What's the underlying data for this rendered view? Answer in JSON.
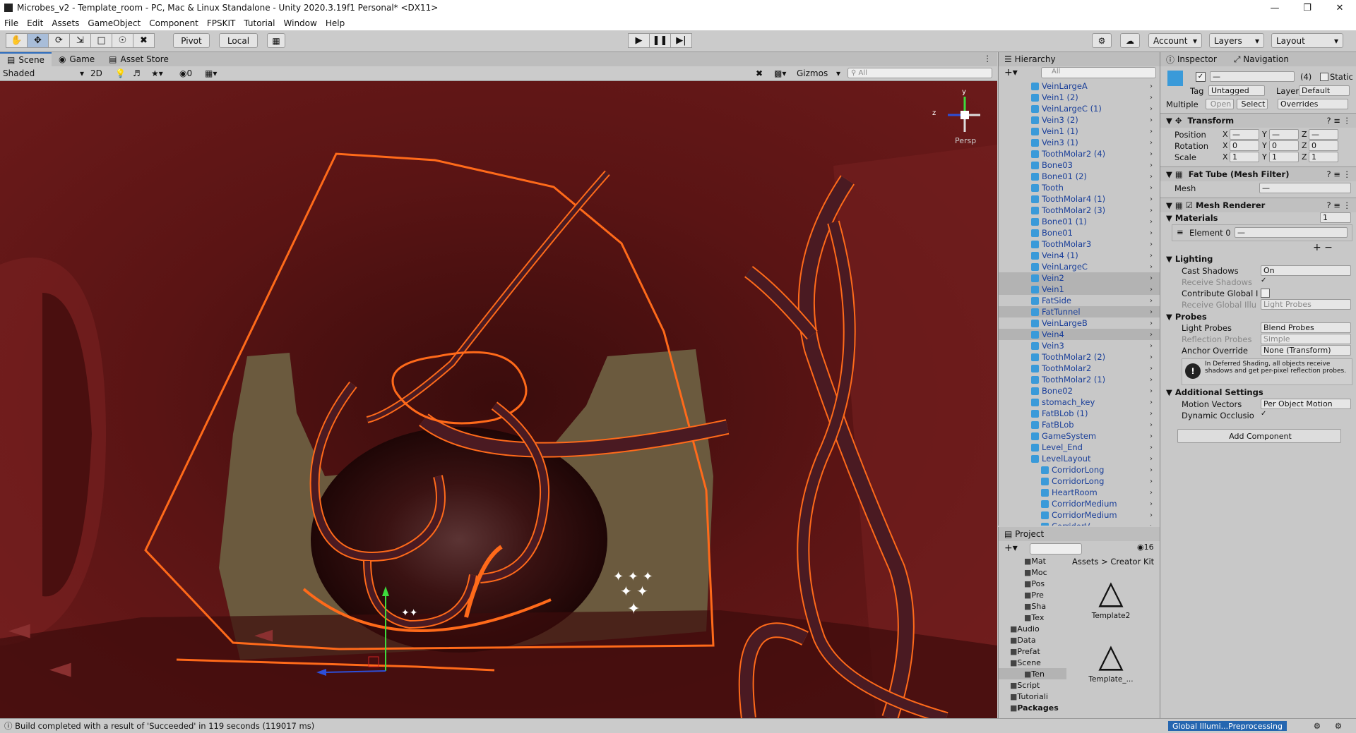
{
  "window": {
    "title": "Microbes_v2 - Template_room - PC, Mac & Linux Standalone - Unity 2020.3.19f1 Personal* <DX11>"
  },
  "menu": [
    "File",
    "Edit",
    "Assets",
    "GameObject",
    "Component",
    "FPSKIT",
    "Tutorial",
    "Window",
    "Help"
  ],
  "toolbar": {
    "pivot": "Pivot",
    "local": "Local",
    "account": "Account",
    "layers": "Layers",
    "layout": "Layout"
  },
  "scene": {
    "tabs": [
      "Scene",
      "Game",
      "Asset Store"
    ],
    "shading": "Shaded",
    "mode_2d": "2D",
    "hidden_count": "0",
    "gizmos": "Gizmos",
    "search_placeholder": "All",
    "persp": "Persp",
    "axis_y": "y",
    "axis_z": "z"
  },
  "hierarchy": {
    "tab": "Hierarchy",
    "search_placeholder": "All",
    "items": [
      {
        "label": "VeinLargeA",
        "sel": false,
        "indent": 1
      },
      {
        "label": "Vein1 (2)",
        "sel": false,
        "indent": 1
      },
      {
        "label": "VeinLargeC (1)",
        "sel": false,
        "indent": 1
      },
      {
        "label": "Vein3 (2)",
        "sel": false,
        "indent": 1
      },
      {
        "label": "Vein1 (1)",
        "sel": false,
        "indent": 1
      },
      {
        "label": "Vein3 (1)",
        "sel": false,
        "indent": 1
      },
      {
        "label": "ToothMolar2 (4)",
        "sel": false,
        "indent": 1
      },
      {
        "label": "Bone03",
        "sel": false,
        "indent": 1
      },
      {
        "label": "Bone01 (2)",
        "sel": false,
        "indent": 1
      },
      {
        "label": "Tooth",
        "sel": false,
        "indent": 1
      },
      {
        "label": "ToothMolar4 (1)",
        "sel": false,
        "indent": 1
      },
      {
        "label": "ToothMolar2 (3)",
        "sel": false,
        "indent": 1
      },
      {
        "label": "Bone01 (1)",
        "sel": false,
        "indent": 1
      },
      {
        "label": "Bone01",
        "sel": false,
        "indent": 1
      },
      {
        "label": "ToothMolar3",
        "sel": false,
        "indent": 1
      },
      {
        "label": "Vein4 (1)",
        "sel": false,
        "indent": 1
      },
      {
        "label": "VeinLargeC",
        "sel": false,
        "indent": 1
      },
      {
        "label": "Vein2",
        "sel": true,
        "indent": 1
      },
      {
        "label": "Vein1",
        "sel": true,
        "indent": 1
      },
      {
        "label": "FatSide",
        "sel": false,
        "indent": 1
      },
      {
        "label": "FatTunnel",
        "sel": true,
        "indent": 1
      },
      {
        "label": "VeinLargeB",
        "sel": false,
        "indent": 1
      },
      {
        "label": "Vein4",
        "sel": true,
        "indent": 1
      },
      {
        "label": "Vein3",
        "sel": false,
        "indent": 1
      },
      {
        "label": "ToothMolar2 (2)",
        "sel": false,
        "indent": 1
      },
      {
        "label": "ToothMolar2",
        "sel": false,
        "indent": 1
      },
      {
        "label": "ToothMolar2 (1)",
        "sel": false,
        "indent": 1
      },
      {
        "label": "Bone02",
        "sel": false,
        "indent": 1
      },
      {
        "label": "stomach_key",
        "sel": false,
        "indent": 1
      },
      {
        "label": "FatBLob (1)",
        "sel": false,
        "indent": 1
      },
      {
        "label": "FatBLob",
        "sel": false,
        "indent": 1
      },
      {
        "label": "GameSystem",
        "sel": false,
        "indent": 1
      },
      {
        "label": "Level_End",
        "sel": false,
        "indent": 1
      },
      {
        "label": "LevelLayout",
        "sel": false,
        "indent": 1
      },
      {
        "label": "CorridorLong",
        "sel": false,
        "indent": 2
      },
      {
        "label": "CorridorLong",
        "sel": false,
        "indent": 2
      },
      {
        "label": "HeartRoom",
        "sel": false,
        "indent": 2
      },
      {
        "label": "CorridorMedium",
        "sel": false,
        "indent": 2
      },
      {
        "label": "CorridorMedium",
        "sel": false,
        "indent": 2
      },
      {
        "label": "CorridorV",
        "sel": false,
        "indent": 2
      }
    ]
  },
  "project": {
    "tab": "Project",
    "hidden_count": "16",
    "breadcrumb": [
      "Assets",
      "Creator Kit"
    ],
    "folders": [
      "Mat",
      "Moc",
      "Pos",
      "Pre",
      "Sha",
      "Tex",
      "Audio",
      "Data",
      "Prefat",
      "Scene",
      "Ten",
      "Script",
      "Tutoriali",
      "Packages"
    ],
    "assets": [
      "Template2",
      "Template_..."
    ]
  },
  "inspector": {
    "tabs": [
      "Inspector",
      "Navigation"
    ],
    "name_value": "—",
    "count": "(4)",
    "static": "Static",
    "tag_label": "Tag",
    "tag_value": "Untagged",
    "layer_label": "Layer",
    "layer_value": "Default",
    "multiple": "Multiple",
    "open": "Open",
    "select": "Select",
    "overrides": "Overrides",
    "transform": {
      "title": "Transform",
      "position": "Position",
      "rotation": "Rotation",
      "scale": "Scale",
      "x": "X",
      "y": "Y",
      "z": "Z",
      "pos": [
        "—",
        "—",
        "—"
      ],
      "rot": [
        "0",
        "0",
        "0"
      ],
      "scl": [
        "1",
        "1",
        "1"
      ]
    },
    "mesh_filter": {
      "title": "Fat Tube (Mesh Filter)",
      "mesh": "Mesh",
      "mesh_value": "—"
    },
    "mesh_renderer": {
      "title": "Mesh Renderer",
      "materials": "Materials",
      "materials_count": "1",
      "element0": "Element 0",
      "element0_value": "—"
    },
    "lighting": {
      "title": "Lighting",
      "cast_shadows": "Cast Shadows",
      "cast_value": "On",
      "receive_shadows": "Receive Shadows",
      "contribute_gi": "Contribute Global I",
      "receive_gi": "Receive Global Illu",
      "receive_gi_value": "Light Probes"
    },
    "probes": {
      "title": "Probes",
      "light_probes": "Light Probes",
      "light_probes_value": "Blend Probes",
      "reflection": "Reflection Probes",
      "reflection_value": "Simple",
      "anchor": "Anchor Override",
      "anchor_value": "None (Transform)",
      "info": "In Deferred Shading, all objects receive shadows and get per-pixel reflection probes."
    },
    "additional": {
      "title": "Additional Settings",
      "motion": "Motion Vectors",
      "motion_value": "Per Object Motion",
      "occlusion": "Dynamic Occlusio"
    },
    "add_component": "Add Component"
  },
  "status": {
    "message": "Build completed with a result of 'Succeeded' in 119 seconds (119017 ms)",
    "gi": "Global Illumi...Preprocessing"
  },
  "colors": {
    "accent": "#2f6ebf",
    "selection_outline": "#ff6a1a",
    "hier_text": "#1a3f99"
  }
}
